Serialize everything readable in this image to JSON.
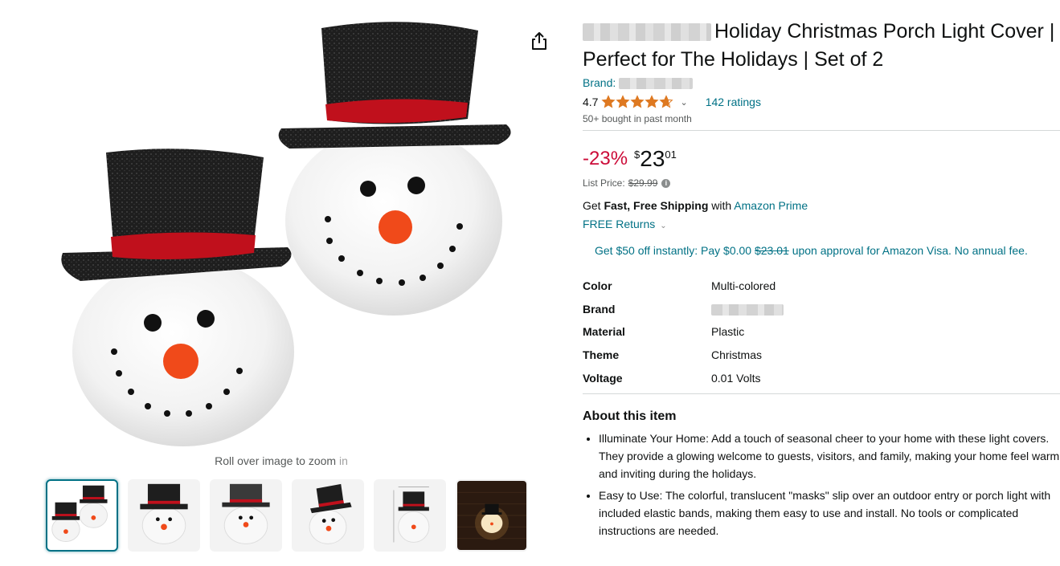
{
  "gallery": {
    "zoom_hint": "Roll over image to zoom",
    "zoom_hint_suffix": "in",
    "share_icon": "share-icon",
    "thumbnails": [
      {
        "name": "two-snowmen",
        "active": true
      },
      {
        "name": "snowman-front"
      },
      {
        "name": "snowman-angle"
      },
      {
        "name": "snowman-side"
      },
      {
        "name": "snowman-dimensions"
      },
      {
        "name": "snowman-lit-night"
      }
    ]
  },
  "product": {
    "title": "Holiday Christmas Porch Light Cover | Perfect for The Holidays | Set of 2",
    "brand_label": "Brand:",
    "rating_value": "4.7",
    "stars": 4.7,
    "ratings_count": "142 ratings",
    "bought": "50+ bought in past month"
  },
  "price": {
    "discount": "-23%",
    "symbol": "$",
    "whole": "23",
    "fraction": "01",
    "list_price_label": "List Price:",
    "list_price": "$29.99",
    "color_discount": "#cc0c39"
  },
  "shipping": {
    "prefix": "Get",
    "bold": "Fast, Free Shipping",
    "middle": "with",
    "prime_link": "Amazon Prime",
    "returns": "FREE Returns"
  },
  "visa_offer": {
    "part1": "Get $50 off instantly: Pay $0.00",
    "struck": "$23.01",
    "part2": "upon approval for Amazon Visa. No annual fee."
  },
  "specs": [
    {
      "key": "Color",
      "value": "Multi-colored"
    },
    {
      "key": "Brand",
      "value": ""
    },
    {
      "key": "Material",
      "value": "Plastic"
    },
    {
      "key": "Theme",
      "value": "Christmas"
    },
    {
      "key": "Voltage",
      "value": "0.01 Volts"
    }
  ],
  "about": {
    "title": "About this item",
    "bullets": [
      "Illuminate Your Home: Add a touch of seasonal cheer to your home with these light covers. They provide a glowing welcome to guests, visitors, and family, making your home feel warm and inviting during the holidays.",
      "Easy to Use: The colorful, translucent \"masks\" slip over an outdoor entry or porch light with included elastic bands, making them easy to use and install. No tools or complicated instructions are needed."
    ]
  },
  "colors": {
    "link": "#007185",
    "hat": "#1b1b1b",
    "hat_band": "#c0101c",
    "nose": "#f04a1a",
    "star": "#de7921"
  }
}
